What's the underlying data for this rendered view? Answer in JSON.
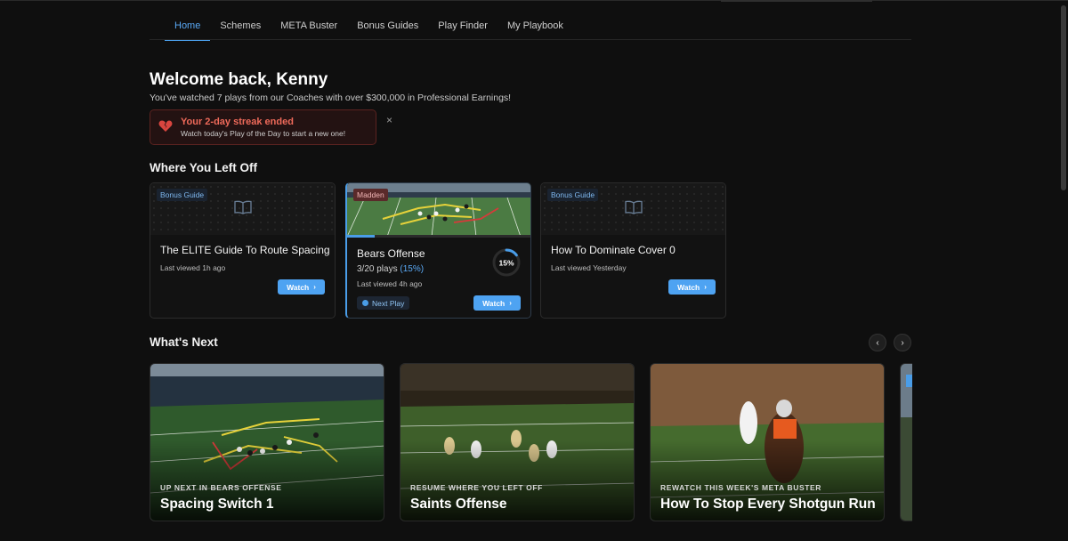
{
  "nav": {
    "items": [
      "Home",
      "Schemes",
      "META Buster",
      "Bonus Guides",
      "Play Finder",
      "My Playbook"
    ]
  },
  "welcome": {
    "title": "Welcome back, Kenny",
    "subtitle": "You've watched 7 plays from our Coaches with over $300,000 in Professional Earnings!"
  },
  "streak": {
    "icon": "broken-heart-icon",
    "title": "Your 2-day streak ended",
    "description": "Watch today's Play of the Day to start a new one!",
    "close": "×"
  },
  "sections": {
    "left_off": "Where You Left Off",
    "whats_next": "What's Next"
  },
  "left_off_cards": [
    {
      "tag": "Bonus Guide",
      "title": "The ELITE Guide To Route Spacing",
      "meta": "Last viewed 1h ago",
      "button": "Watch",
      "icon": "book-icon"
    },
    {
      "tag": "Madden",
      "title": "Bears Offense",
      "plays_text": "3/20 plays",
      "plays_pct": "(15%)",
      "progress_percent": 15,
      "ring_label": "15%",
      "meta": "Last viewed 4h ago",
      "next_label": "Next Play",
      "button": "Watch"
    },
    {
      "tag": "Bonus Guide",
      "title": "How To Dominate Cover 0",
      "meta": "Last viewed Yesterday",
      "button": "Watch",
      "icon": "book-icon"
    }
  ],
  "whats_next_cards": [
    {
      "subtitle": "UP NEXT IN BEARS OFFENSE",
      "title": "Spacing Switch 1"
    },
    {
      "subtitle": "RESUME WHERE YOU LEFT OFF",
      "title": "Saints Offense"
    },
    {
      "subtitle": "REWATCH THIS WEEK'S META BUSTER",
      "title": "How To Stop Every Shotgun Run"
    }
  ],
  "arrows": {
    "prev": "‹",
    "next": "›"
  },
  "colors": {
    "accent": "#4ea3f2",
    "background": "#0f0f0f",
    "streak_red": "#ef6a5a"
  }
}
